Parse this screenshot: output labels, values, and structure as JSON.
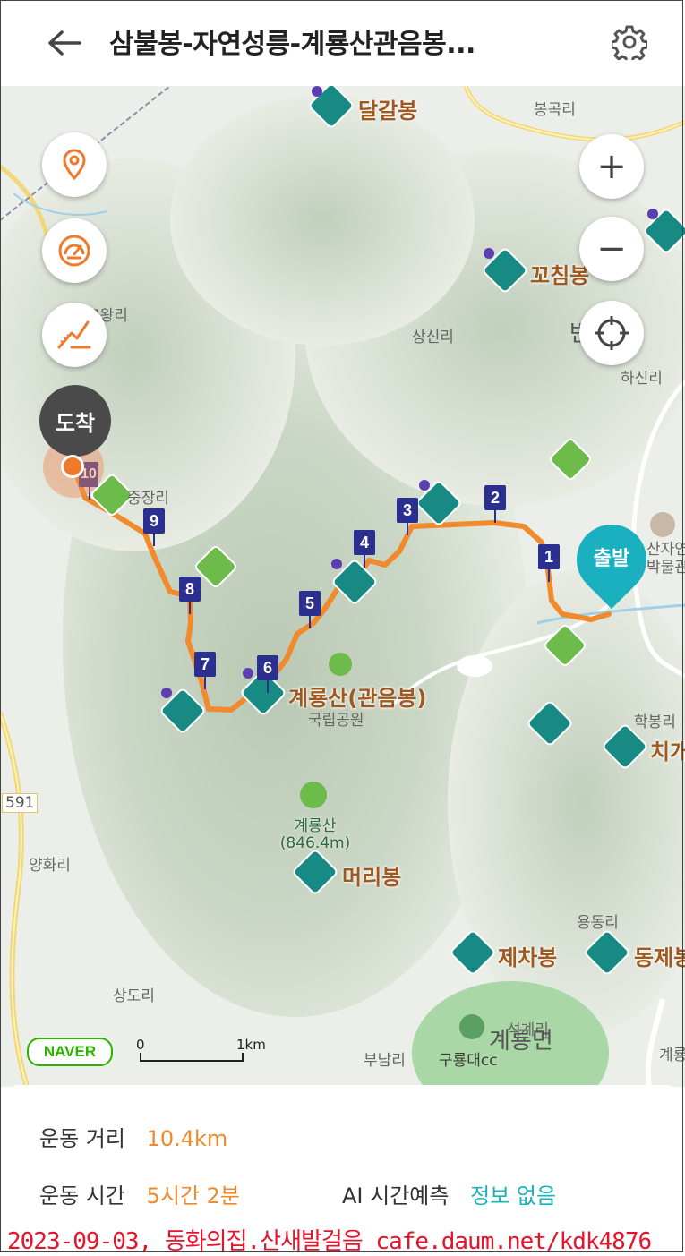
{
  "header": {
    "title": "삼불봉-자연성릉-계룡산관음봉...",
    "back_icon": "back-arrow-icon",
    "settings_icon": "gear-icon"
  },
  "map": {
    "controls": {
      "location_icon": "location-pin-icon",
      "speed_icon": "speedometer-icon",
      "elevation_icon": "elevation-profile-icon",
      "zoom_in": "+",
      "zoom_out": "−",
      "gps_icon": "crosshair-icon"
    },
    "arrival_label": "도착",
    "start_label": "출발",
    "waypoints": [
      "1",
      "2",
      "3",
      "4",
      "5",
      "6",
      "7",
      "8",
      "9",
      "10"
    ],
    "places": {
      "dalgalbong": "달갈봉",
      "bonggokri": "봉곡리",
      "kkochimbong": "꼬침봉",
      "gowangri": "고왕리",
      "sangsinri": "상신리",
      "hasinri": "하신리",
      "banpo": "반포면",
      "jungjangri": "중장리",
      "museum": "산자연박물관",
      "gyeryongsan_gwaneumbong": "계룡산(관음봉)",
      "national_park": "국립공원",
      "hakbongri": "학봉리",
      "chi": "치개봉",
      "road591": "591",
      "gyeryongsan_peak": "계룡산",
      "gyeryongsan_height": "(846.4m)",
      "yanghwari": "양화리",
      "meoribong": "머리봉",
      "yongdongri": "용동리",
      "jechabong": "제차봉",
      "dongje": "동제봉",
      "sangdori": "상도리",
      "sinwonsa": "석계리",
      "gyeryongmyeon": "계룡면",
      "bunamri": "부남리",
      "guryongdae": "구룡대cc",
      "gyeryong_right": "계룡"
    },
    "naver": "NAVER",
    "scale_start": "0",
    "scale_end": "1km"
  },
  "stats": {
    "distance_label": "운동 거리",
    "distance_value": "10.4km",
    "time_label": "운동 시간",
    "time_value": "5시간 2분",
    "ai_label": "AI 시간예측",
    "ai_value": "정보 없음"
  },
  "watermark": "2023-09-03, 동화의집.산새발걸음 cafe.daum.net/kdk4876"
}
